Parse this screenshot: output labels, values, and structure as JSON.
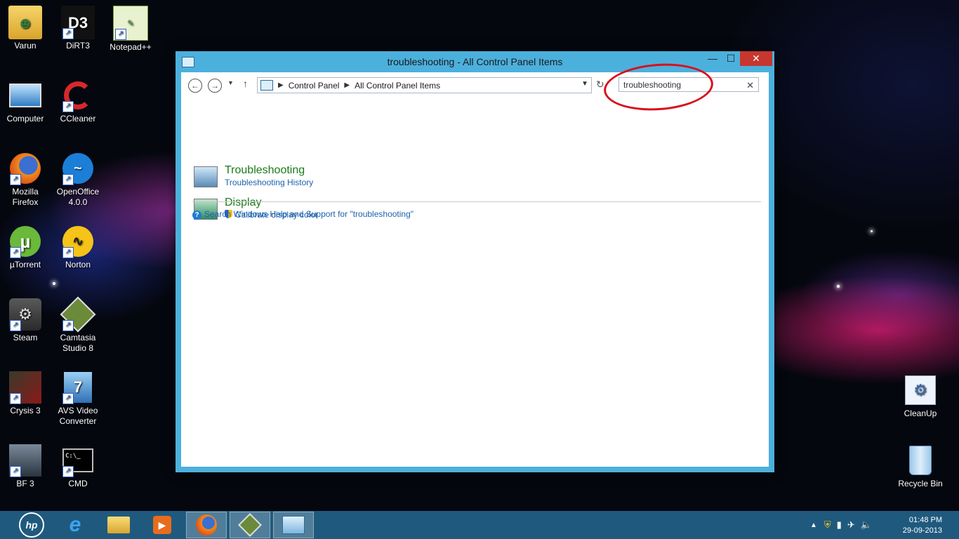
{
  "desktop": {
    "icons": [
      {
        "label": "Varun",
        "icon": "user-folder-icon"
      },
      {
        "label": "DiRT3",
        "icon": "dirt3-icon"
      },
      {
        "label": "Notepad++",
        "icon": "notepadpp-icon"
      },
      {
        "label": "Computer",
        "icon": "computer-icon"
      },
      {
        "label": "CCleaner",
        "icon": "ccleaner-icon"
      },
      {
        "label": "Mozilla Firefox",
        "icon": "firefox-icon"
      },
      {
        "label": "OpenOffice 4.0.0",
        "icon": "openoffice-icon"
      },
      {
        "label": "µTorrent",
        "icon": "utorrent-icon"
      },
      {
        "label": "Norton",
        "icon": "norton-icon"
      },
      {
        "label": "Steam",
        "icon": "steam-icon"
      },
      {
        "label": "Camtasia Studio 8",
        "icon": "camtasia-icon"
      },
      {
        "label": "Crysis 3",
        "icon": "crysis-icon"
      },
      {
        "label": "AVS Video Converter",
        "icon": "avs-icon"
      },
      {
        "label": "BF 3",
        "icon": "bf3-icon"
      },
      {
        "label": "CMD",
        "icon": "cmd-icon"
      },
      {
        "label": "CleanUp",
        "icon": "cleanup-icon"
      },
      {
        "label": "Recycle Bin",
        "icon": "recycle-bin-icon"
      }
    ]
  },
  "window": {
    "title": "troubleshooting - All Control Panel Items",
    "close_label": "✕",
    "maximize_label": "☐",
    "minimize_label": "—"
  },
  "navbar": {
    "breadcrumb": [
      "Control Panel",
      "All Control Panel Items"
    ],
    "search_value": "troubleshooting"
  },
  "results": [
    {
      "title": "Troubleshooting",
      "link": "Troubleshooting History",
      "shield": false
    },
    {
      "title": "Display",
      "link": "Calibrate display color",
      "shield": true
    }
  ],
  "help_link": "Search Windows Help and Support for \"troubleshooting\"",
  "taskbar": {
    "apps": [
      "hp-icon",
      "internet-explorer-icon",
      "file-explorer-icon",
      "media-player-icon",
      "firefox-icon",
      "camtasia-icon",
      "control-panel-icon"
    ],
    "time": "01:48 PM",
    "date": "29-09-2013"
  },
  "colors": {
    "window_frame": "#4cb0dd",
    "close_button": "#c7372f",
    "result_title": "#1a7b1a",
    "link": "#1c63ad",
    "annotation_oval": "#d8101c",
    "taskbar": "#1f5a7e"
  }
}
